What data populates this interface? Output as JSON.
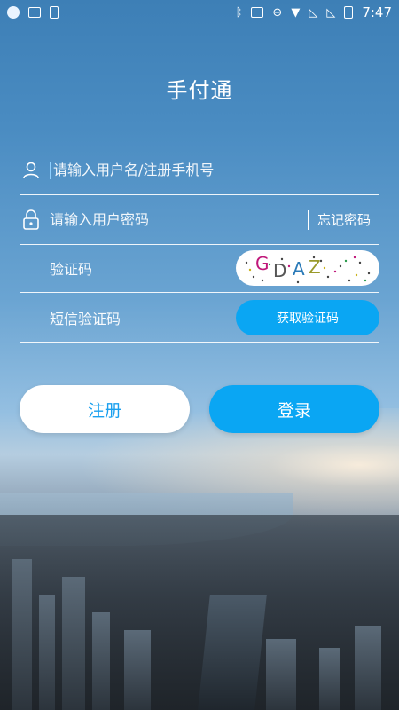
{
  "status_bar": {
    "time": "7:47"
  },
  "app": {
    "title": "手付通"
  },
  "form": {
    "username_placeholder": "请输入用户名/注册手机号",
    "password_placeholder": "请输入用户密码",
    "forgot_password": "忘记密码",
    "captcha_label": "验证码",
    "captcha_text": "GDAZ",
    "sms_label": "短信验证码",
    "sms_button": "获取验证码"
  },
  "actions": {
    "register": "注册",
    "login": "登录"
  },
  "colors": {
    "accent": "#0aa6f3",
    "register_text": "#1aa0ef"
  }
}
